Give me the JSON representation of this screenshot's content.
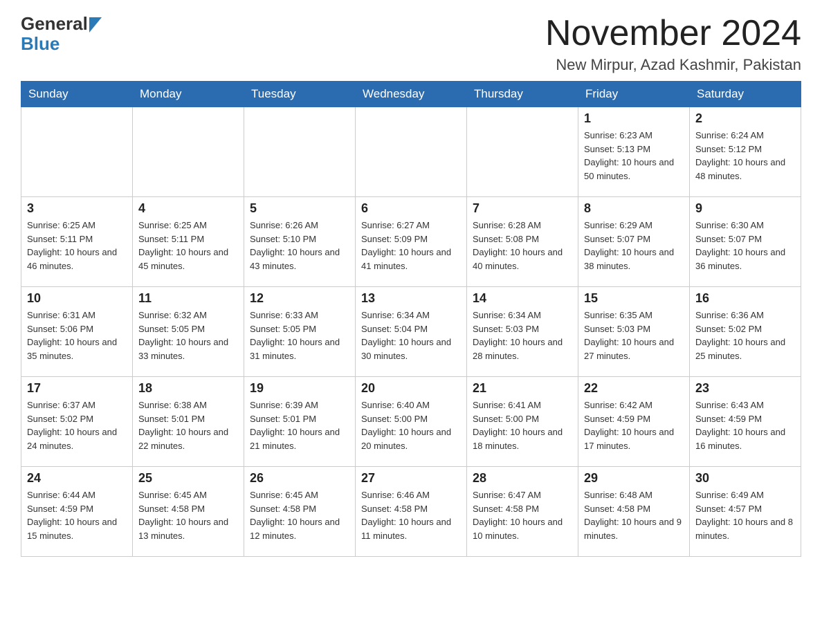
{
  "header": {
    "logo_general": "General",
    "logo_blue": "Blue",
    "month_title": "November 2024",
    "location": "New Mirpur, Azad Kashmir, Pakistan"
  },
  "weekdays": [
    "Sunday",
    "Monday",
    "Tuesday",
    "Wednesday",
    "Thursday",
    "Friday",
    "Saturday"
  ],
  "weeks": [
    [
      {
        "day": "",
        "info": ""
      },
      {
        "day": "",
        "info": ""
      },
      {
        "day": "",
        "info": ""
      },
      {
        "day": "",
        "info": ""
      },
      {
        "day": "",
        "info": ""
      },
      {
        "day": "1",
        "info": "Sunrise: 6:23 AM\nSunset: 5:13 PM\nDaylight: 10 hours and 50 minutes."
      },
      {
        "day": "2",
        "info": "Sunrise: 6:24 AM\nSunset: 5:12 PM\nDaylight: 10 hours and 48 minutes."
      }
    ],
    [
      {
        "day": "3",
        "info": "Sunrise: 6:25 AM\nSunset: 5:11 PM\nDaylight: 10 hours and 46 minutes."
      },
      {
        "day": "4",
        "info": "Sunrise: 6:25 AM\nSunset: 5:11 PM\nDaylight: 10 hours and 45 minutes."
      },
      {
        "day": "5",
        "info": "Sunrise: 6:26 AM\nSunset: 5:10 PM\nDaylight: 10 hours and 43 minutes."
      },
      {
        "day": "6",
        "info": "Sunrise: 6:27 AM\nSunset: 5:09 PM\nDaylight: 10 hours and 41 minutes."
      },
      {
        "day": "7",
        "info": "Sunrise: 6:28 AM\nSunset: 5:08 PM\nDaylight: 10 hours and 40 minutes."
      },
      {
        "day": "8",
        "info": "Sunrise: 6:29 AM\nSunset: 5:07 PM\nDaylight: 10 hours and 38 minutes."
      },
      {
        "day": "9",
        "info": "Sunrise: 6:30 AM\nSunset: 5:07 PM\nDaylight: 10 hours and 36 minutes."
      }
    ],
    [
      {
        "day": "10",
        "info": "Sunrise: 6:31 AM\nSunset: 5:06 PM\nDaylight: 10 hours and 35 minutes."
      },
      {
        "day": "11",
        "info": "Sunrise: 6:32 AM\nSunset: 5:05 PM\nDaylight: 10 hours and 33 minutes."
      },
      {
        "day": "12",
        "info": "Sunrise: 6:33 AM\nSunset: 5:05 PM\nDaylight: 10 hours and 31 minutes."
      },
      {
        "day": "13",
        "info": "Sunrise: 6:34 AM\nSunset: 5:04 PM\nDaylight: 10 hours and 30 minutes."
      },
      {
        "day": "14",
        "info": "Sunrise: 6:34 AM\nSunset: 5:03 PM\nDaylight: 10 hours and 28 minutes."
      },
      {
        "day": "15",
        "info": "Sunrise: 6:35 AM\nSunset: 5:03 PM\nDaylight: 10 hours and 27 minutes."
      },
      {
        "day": "16",
        "info": "Sunrise: 6:36 AM\nSunset: 5:02 PM\nDaylight: 10 hours and 25 minutes."
      }
    ],
    [
      {
        "day": "17",
        "info": "Sunrise: 6:37 AM\nSunset: 5:02 PM\nDaylight: 10 hours and 24 minutes."
      },
      {
        "day": "18",
        "info": "Sunrise: 6:38 AM\nSunset: 5:01 PM\nDaylight: 10 hours and 22 minutes."
      },
      {
        "day": "19",
        "info": "Sunrise: 6:39 AM\nSunset: 5:01 PM\nDaylight: 10 hours and 21 minutes."
      },
      {
        "day": "20",
        "info": "Sunrise: 6:40 AM\nSunset: 5:00 PM\nDaylight: 10 hours and 20 minutes."
      },
      {
        "day": "21",
        "info": "Sunrise: 6:41 AM\nSunset: 5:00 PM\nDaylight: 10 hours and 18 minutes."
      },
      {
        "day": "22",
        "info": "Sunrise: 6:42 AM\nSunset: 4:59 PM\nDaylight: 10 hours and 17 minutes."
      },
      {
        "day": "23",
        "info": "Sunrise: 6:43 AM\nSunset: 4:59 PM\nDaylight: 10 hours and 16 minutes."
      }
    ],
    [
      {
        "day": "24",
        "info": "Sunrise: 6:44 AM\nSunset: 4:59 PM\nDaylight: 10 hours and 15 minutes."
      },
      {
        "day": "25",
        "info": "Sunrise: 6:45 AM\nSunset: 4:58 PM\nDaylight: 10 hours and 13 minutes."
      },
      {
        "day": "26",
        "info": "Sunrise: 6:45 AM\nSunset: 4:58 PM\nDaylight: 10 hours and 12 minutes."
      },
      {
        "day": "27",
        "info": "Sunrise: 6:46 AM\nSunset: 4:58 PM\nDaylight: 10 hours and 11 minutes."
      },
      {
        "day": "28",
        "info": "Sunrise: 6:47 AM\nSunset: 4:58 PM\nDaylight: 10 hours and 10 minutes."
      },
      {
        "day": "29",
        "info": "Sunrise: 6:48 AM\nSunset: 4:58 PM\nDaylight: 10 hours and 9 minutes."
      },
      {
        "day": "30",
        "info": "Sunrise: 6:49 AM\nSunset: 4:57 PM\nDaylight: 10 hours and 8 minutes."
      }
    ]
  ]
}
